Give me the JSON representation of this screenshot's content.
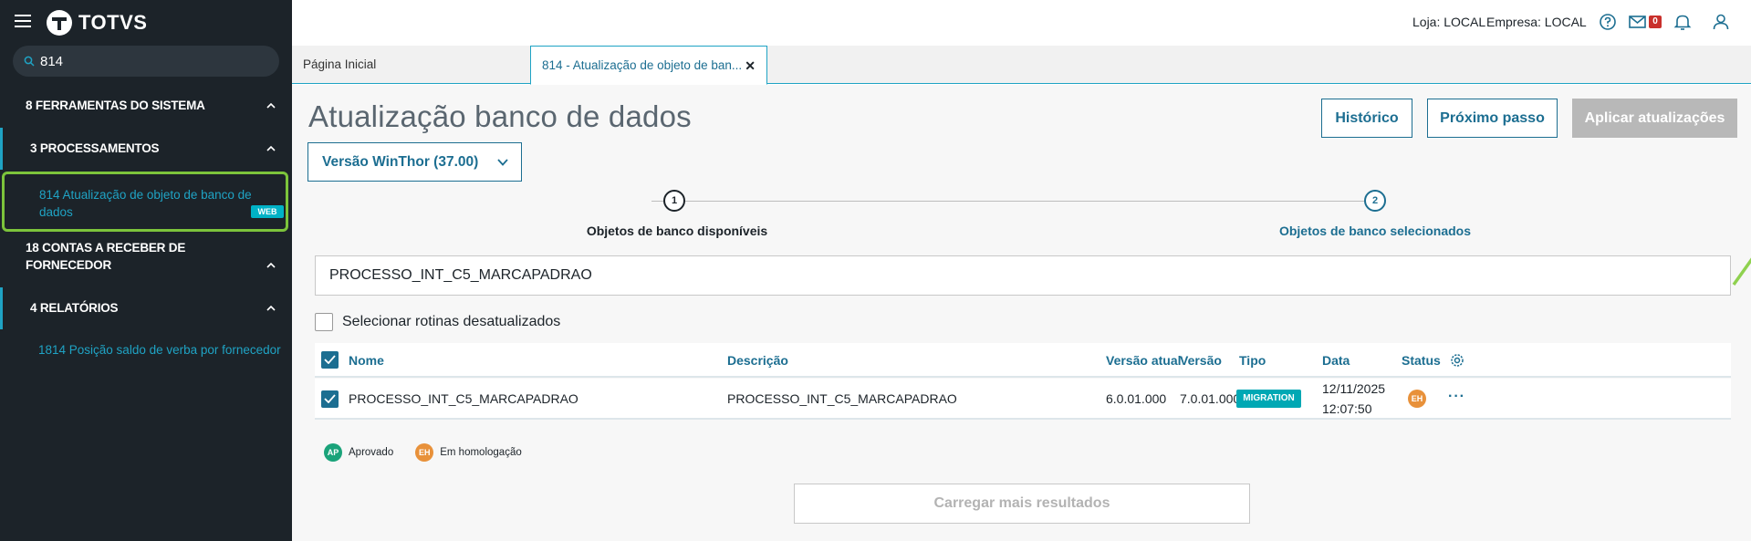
{
  "app": {
    "brand": "TOTVS"
  },
  "sidebar": {
    "search_value": "814",
    "sections": [
      {
        "label": "8  FERRAMENTAS DO SISTEMA"
      },
      {
        "label": "3  PROCESSAMENTOS"
      },
      {
        "label": "18  CONTAS A RECEBER DE FORNECEDOR"
      },
      {
        "label": "4  RELATÓRIOS"
      }
    ],
    "selected_item": {
      "label": "814  Atualização de objeto de banco de dados",
      "badge": "WEB"
    },
    "sub_item": {
      "label": "1814  Posição saldo de verba por fornecedor"
    }
  },
  "header": {
    "loja": "Loja: LOCAL",
    "empresa": "Empresa: LOCAL",
    "mail_count": "0"
  },
  "tabs": [
    {
      "label": "Página Inicial"
    },
    {
      "label": "814 - Atualização de objeto de ban..."
    }
  ],
  "main": {
    "title": "Atualização banco de dados",
    "version_select": "Versão WinThor (37.00)",
    "buttons": {
      "historico": "Histórico",
      "proximo": "Próximo passo",
      "aplicar": "Aplicar atualizações"
    },
    "stepper": [
      {
        "num": "1",
        "label": "Objetos de banco disponíveis"
      },
      {
        "num": "2",
        "label": "Objetos de banco selecionados"
      }
    ],
    "filter_value": "PROCESSO_INT_C5_MARCAPADRAO",
    "checkbox_label": "Selecionar rotinas desatualizados",
    "table": {
      "headers": {
        "nome": "Nome",
        "descricao": "Descrição",
        "versao_atual": "Versão atual",
        "versao": "Versão",
        "tipo": "Tipo",
        "data": "Data",
        "status": "Status"
      },
      "rows": [
        {
          "nome": "PROCESSO_INT_C5_MARCAPADRAO",
          "descricao": "PROCESSO_INT_C5_MARCAPADRAO",
          "versao_atual": "6.0.01.000",
          "versao": "7.0.01.000",
          "tipo": "MIGRATION",
          "data": "12/11/2025",
          "hora": "12:07:50",
          "status": "EH"
        }
      ]
    },
    "legend": [
      {
        "code": "AP",
        "label": "Aprovado",
        "color": "#1aa37a"
      },
      {
        "code": "EH",
        "label": "Em homologação",
        "color": "#e8913a"
      }
    ],
    "load_more": "Carregar mais resultados"
  },
  "colors": {
    "accent": "#1c6e91",
    "highlight": "#7cc43b",
    "sidebar_bg": "#1c2329"
  }
}
